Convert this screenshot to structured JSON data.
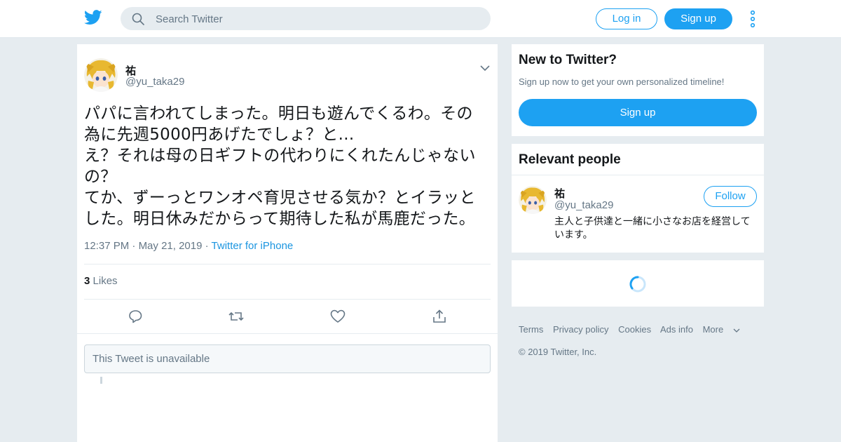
{
  "colors": {
    "accent": "#1da1f2",
    "page_bg": "#e6ecf0",
    "text": "#14171a",
    "muted": "#657786"
  },
  "header": {
    "logo_icon": "twitter-bird-icon",
    "search": {
      "placeholder": "Search Twitter",
      "value": ""
    },
    "login_label": "Log in",
    "signup_label": "Sign up",
    "more_icon": "vertical-dots-icon"
  },
  "tweet": {
    "display_name": "祐",
    "handle": "@yu_taka29",
    "text": "パパに言われてしまった。明日も遊んでくるわ。その\n為に先週5000円あげたでしょ？と...\nえ？それは母の日ギフトの代わりにくれたんじゃない\nの？\nてか、ずーっとワンオペ育児させる気か？とイラッと\nした。明日休みだからって期待した私が馬鹿だった。",
    "time": "12:37 PM",
    "date": "May 21, 2019",
    "source": "Twitter for iPhone",
    "likes_count": "3",
    "likes_label": "Likes",
    "unavailable_text": "This Tweet is unavailable"
  },
  "sidebar": {
    "signup": {
      "title": "New to Twitter?",
      "subtitle": "Sign up now to get your own personalized timeline!",
      "button_label": "Sign up"
    },
    "relevant": {
      "title": "Relevant people",
      "person": {
        "display_name": "祐",
        "handle": "@yu_taka29",
        "follow_label": "Follow",
        "bio": "主人と子供達と一緒に小さなお店を経営しています。"
      }
    },
    "footer": {
      "links": [
        "Terms",
        "Privacy policy",
        "Cookies",
        "Ads info",
        "More"
      ],
      "copyright": "© 2019 Twitter, Inc."
    }
  }
}
